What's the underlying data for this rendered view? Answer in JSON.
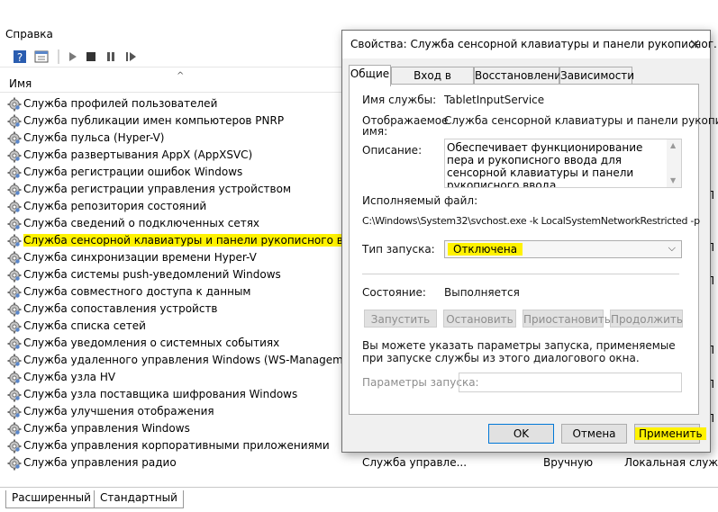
{
  "menubar": {
    "help": "Справка"
  },
  "toolbar": {
    "icons": [
      "help-icon",
      "view-icon",
      "play-icon",
      "stop-icon",
      "pause-icon",
      "resume-icon"
    ]
  },
  "list": {
    "column_name": "Имя",
    "rows": [
      "Служба профилей пользователей",
      "Служба публикации имен компьютеров PNRP",
      "Служба пульса (Hyper-V)",
      "Служба развертывания AppX (AppXSVC)",
      "Служба регистрации ошибок Windows",
      "Служба регистрации управления устройством",
      "Служба репозитория состояний",
      "Служба сведений о подключенных сетях",
      "Служба сенсорной клавиатуры и панели рукописного ввода",
      "Служба синхронизации времени Hyper-V",
      "Служба системы push-уведомлений Windows",
      "Служба совместного доступа к данным",
      "Служба сопоставления устройств",
      "Служба списка сетей",
      "Служба уведомления о системных событиях",
      "Служба удаленного управления Windows (WS-Management)",
      "Служба узла HV",
      "Служба узла поставщика шифрования Windows",
      "Служба улучшения отображения",
      "Служба управления Windows",
      "Служба управления корпоративными приложениями",
      "Служба управления радио"
    ],
    "last_row_extra": {
      "description": "Служба управле...",
      "startup": "Вручную",
      "logon": "Локальная служба"
    }
  },
  "bottom_tabs": [
    "Расширенный",
    "Стандартный"
  ],
  "dialog": {
    "title": "Свойства: Служба сенсорной клавиатуры и панели рукописног...",
    "tabs": [
      "Общие",
      "Вход в систему",
      "Восстановление",
      "Зависимости"
    ],
    "service_name_label": "Имя службы:",
    "service_name": "TabletInputService",
    "display_name_label_1": "Отображаемое",
    "display_name_label_2": "имя:",
    "display_name": "Служба сенсорной клавиатуры и панели рукописног",
    "description_label": "Описание:",
    "description": "Обеспечивает функционирование пера и рукописного ввода для сенсорной клавиатуры и панели рукописного ввода",
    "exe_label": "Исполняемый файл:",
    "exe_path": "C:\\Windows\\System32\\svchost.exe -k LocalSystemNetworkRestricted -p",
    "startup_type_label": "Тип запуска:",
    "startup_type_value": "Отключена",
    "status_label": "Состояние:",
    "status_value": "Выполняется",
    "buttons": {
      "start": "Запустить",
      "stop": "Остановить",
      "pause": "Приостановить",
      "resume": "Продолжить"
    },
    "hint": "Вы можете указать параметры запуска, применяемые при запуске службы из этого диалогового окна.",
    "params_label": "Параметры запуска:",
    "ok": "OK",
    "cancel": "Отмена",
    "apply": "Применить"
  },
  "colors": {
    "highlight": "#fff200",
    "accent": "#0078d7"
  }
}
